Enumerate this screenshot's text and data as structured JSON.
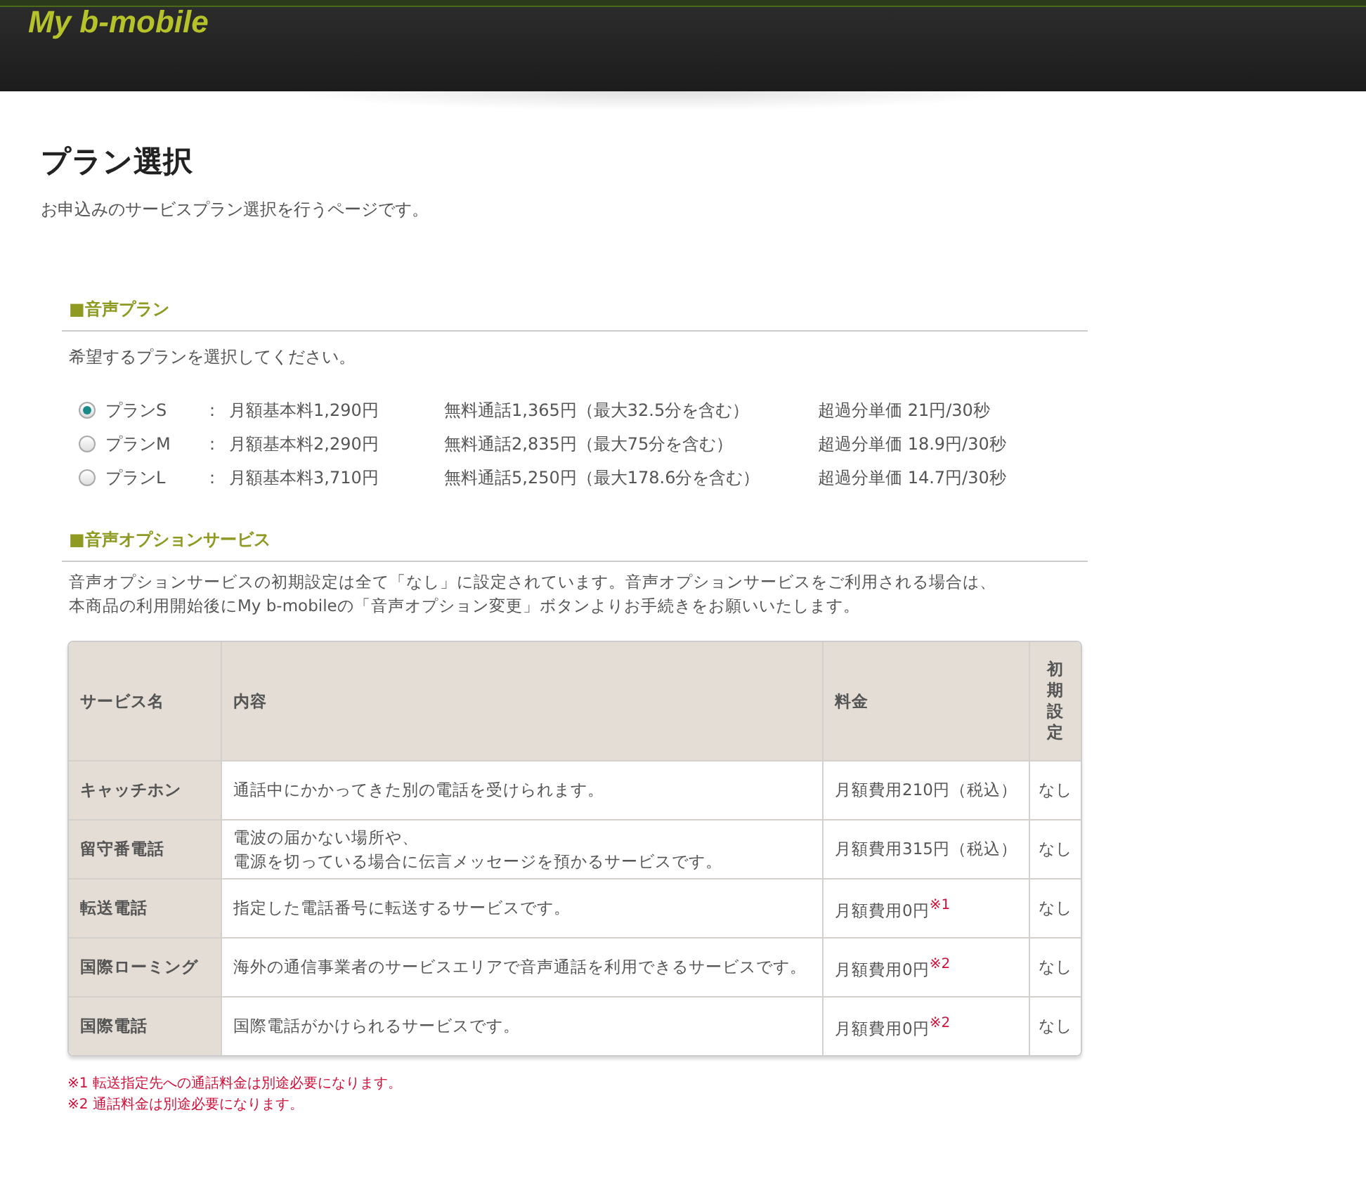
{
  "header": {
    "logo": "My b-mobile"
  },
  "page": {
    "title": "プラン選択",
    "subtitle": "お申込みのサービスプラン選択を行うページです。"
  },
  "voice_plan": {
    "heading": "■音声プラン",
    "instruction": "希望するプランを選択してください。",
    "plans": [
      {
        "name": "プランS",
        "separator": "：",
        "base_fee": "月額基本料1,290円",
        "free_calls": "無料通話1,365円（最大32.5分を含む）",
        "overage": "超過分単価 21円/30秒",
        "selected": true
      },
      {
        "name": "プランM",
        "separator": "：",
        "base_fee": "月額基本料2,290円",
        "free_calls": "無料通話2,835円（最大75分を含む）",
        "overage": "超過分単価 18.9円/30秒",
        "selected": false
      },
      {
        "name": "プランL",
        "separator": "：",
        "base_fee": "月額基本料3,710円",
        "free_calls": "無料通話5,250円（最大178.6分を含む）",
        "overage": "超過分単価 14.7円/30秒",
        "selected": false
      }
    ]
  },
  "voice_options": {
    "heading": "■音声オプションサービス",
    "description": [
      "音声オプションサービスの初期設定は全て「なし」に設定されています。音声オプションサービスをご利用される場合は、",
      "本商品の利用開始後にMy b-mobileの「音声オプション変更」ボタンよりお手続きをお願いいたします。"
    ],
    "table": {
      "columns": [
        "サービス名",
        "内容",
        "料金",
        "初期設定"
      ],
      "rows": [
        [
          "キャッチホン",
          "通話中にかかってきた別の電話を受けられます。",
          "月額費用210円（税込）",
          "なし"
        ],
        [
          "留守番電話",
          [
            "電波の届かない場所や、",
            "電源を切っている場合に伝言メッセージを預かるサービスです。"
          ],
          "月額費用315円（税込）",
          "なし"
        ],
        [
          "転送電話",
          "指定した電話番号に転送するサービスです。",
          "月額費用0円$^{※1}$",
          "なし"
        ],
        [
          "国際ローミング",
          "海外の通信事業者のサービスエリアで音声通話を利用できるサービスです。",
          "月額費用0円$^{※2}$",
          "なし"
        ],
        [
          "国際電話",
          "国際電話がかけられるサービスです。",
          "月額費用0円$^{※2}$",
          "なし"
        ]
      ]
    },
    "notes": [
      "※1 転送指定先への通話料金は別途必要になります。",
      "※2 通話料金は別途必要になります。"
    ]
  }
}
